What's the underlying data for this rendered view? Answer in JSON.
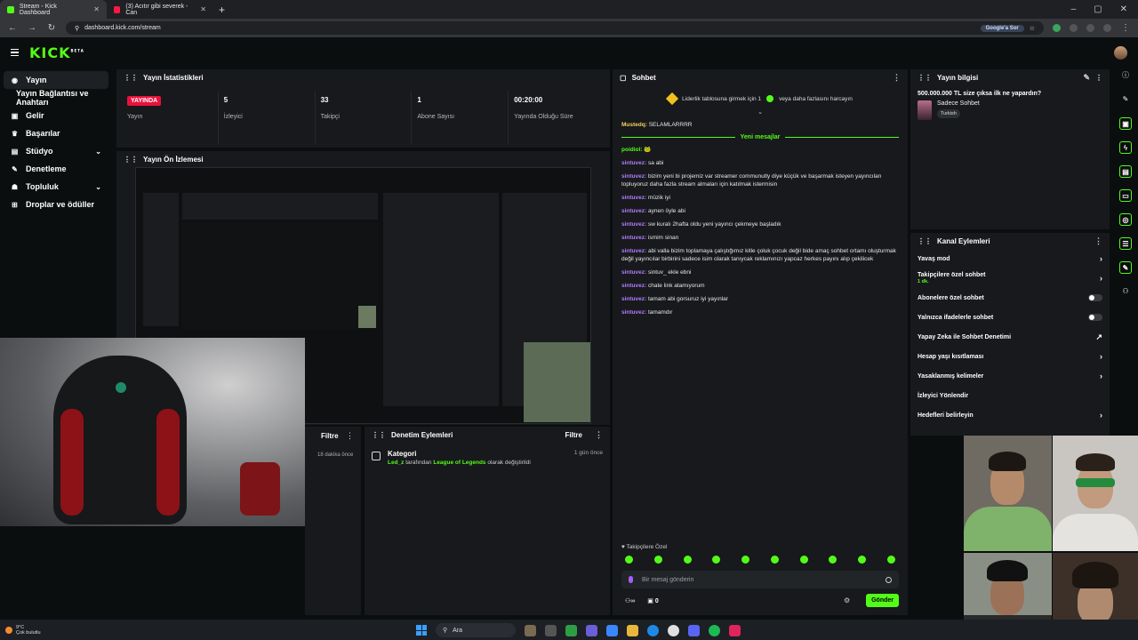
{
  "browser": {
    "tabs": [
      {
        "label": "Stream - Kick Dashboard",
        "color": "#53fc18"
      },
      {
        "label": "(3) Acıtır gibi severek - Can",
        "color": "#ff1744"
      }
    ],
    "url": "dashboard.kick.com/stream",
    "google_label": "Google'a Sor"
  },
  "kick": {
    "logo": "KICK",
    "beta": "BETA"
  },
  "sidebar": {
    "items": [
      {
        "label": "Yayın",
        "icon": "broadcast-icon"
      },
      {
        "label": "Yayın Bağlantısı ve Anahtarı"
      },
      {
        "label": "Gelir",
        "icon": "wallet-icon"
      },
      {
        "label": "Başarılar",
        "icon": "trophy-icon"
      },
      {
        "label": "Stüdyo",
        "icon": "studio-icon"
      },
      {
        "label": "Denetleme",
        "icon": "wrench-icon"
      },
      {
        "label": "Topluluk",
        "icon": "community-icon"
      },
      {
        "label": "Droplar ve ödüller",
        "icon": "gift-icon"
      }
    ]
  },
  "stats": {
    "title": "Yayın İstatistikleri",
    "live_badge": "YAYINDA",
    "items": [
      {
        "value": "",
        "label": "Yayın"
      },
      {
        "value": "5",
        "label": "İzleyici"
      },
      {
        "value": "33",
        "label": "Takipçi"
      },
      {
        "value": "1",
        "label": "Abone Sayısı"
      },
      {
        "value": "00:20:00",
        "label": "Yayında Olduğu Süre"
      }
    ]
  },
  "preview": {
    "title": "Yayın Ön İzlemesi"
  },
  "filter_strip": {
    "label": "Filtre",
    "time": "18 dakika önce"
  },
  "modlog": {
    "title": "Denetim Eylemleri",
    "filter": "Filtre",
    "entries": [
      {
        "head": "Kategori",
        "user": "Led_z",
        "mid": " tarafından ",
        "game": "League of Legends",
        "tail": " olarak değiştirildi",
        "time": "1 gün önce"
      }
    ]
  },
  "chat": {
    "title": "Sohbet",
    "pinned": "Liderlik tablosuna girmek için 1",
    "pinned_tail": "veya daha fazlasını harcayın",
    "first": {
      "user": "Mustedq:",
      "text": " SELAMLARRRR"
    },
    "new_messages": "Yeni mesajlar",
    "messages": [
      {
        "user": "poidiol:",
        "text": " 🐸"
      },
      {
        "user": "sintuvez:",
        "text": " sa abi"
      },
      {
        "user": "sintuvez:",
        "text": " bizim yeni bi projemiz var streamer communutly diye küçük ve başarmak isteyen yayıncıları topluyoruz daha fazla stream almaları için katılmak istermisin"
      },
      {
        "user": "sintuvez:",
        "text": " müzik iyi"
      },
      {
        "user": "sintuvez:",
        "text": " aynen öyle abi"
      },
      {
        "user": "sintuvez:",
        "text": " sw kuralı 2hafta oldu yeni yayıncı çekmeye başladık"
      },
      {
        "user": "sintuvez:",
        "text": " ismim sinan"
      },
      {
        "user": "sintuvez:",
        "text": " abi valla bizim toplamaya çalıştığımız kitle çoluk çocuk değil bide amaç sohbet ortamı oluşturmak değil yayıncılar birbirini sadece isim olarak tanıycak reklamınızı yapcaz herkes payını alıp çekilicek"
      },
      {
        "user": "sintuvez:",
        "text": " sintuv_ ekle ebni"
      },
      {
        "user": "sintuvez:",
        "text": " chate link atamıyorum"
      },
      {
        "user": "sintuvez:",
        "text": " tamam abi gorsuruz iyi yayınlar"
      },
      {
        "user": "sintuvez:",
        "text": " tamamdır"
      }
    ],
    "follow_label": "♥ Takipçilere Özel",
    "input_placeholder": "Bir mesaj gönderin",
    "points": "0",
    "send": "Gönder"
  },
  "info": {
    "title": "Yayın bilgisi",
    "stream_title": "500.000.000 TL size çıksa ilk ne yapardın?",
    "category": "Sadece Sohbet",
    "language": "Turkish"
  },
  "actions": {
    "title": "Kanal Eylemleri",
    "items": [
      {
        "label": "Yavaş mod",
        "kind": "arrow"
      },
      {
        "label": "Takipçilere özel sohbet",
        "sub": "1 dk.",
        "kind": "arrow"
      },
      {
        "label": "Abonelere özel sohbet",
        "kind": "toggle"
      },
      {
        "label": "Yalnızca ifadelerle sohbet",
        "kind": "toggle"
      },
      {
        "label": "Yapay Zeka ile Sohbet Denetimi",
        "kind": "external"
      },
      {
        "label": "Hesap yaşı kısıtlaması",
        "kind": "arrow"
      },
      {
        "label": "Yasaklanmış kelimeler",
        "kind": "arrow"
      },
      {
        "label": "İzleyici Yönlendir",
        "kind": "none"
      },
      {
        "label": "Hedefleri belirleyin",
        "kind": "arrow"
      }
    ]
  },
  "taskbar": {
    "temp": "9°C",
    "weather": "Çok bulutlu",
    "search": "Ara"
  }
}
